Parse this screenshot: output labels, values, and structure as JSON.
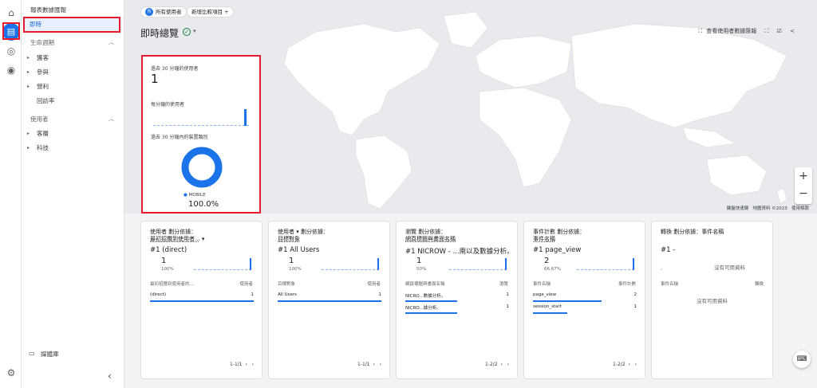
{
  "rail": {
    "icons": [
      "home-icon",
      "reports-icon",
      "explore-icon",
      "advertising-icon",
      "settings-icon"
    ]
  },
  "sidebar": {
    "header": "報表數據匯報",
    "selected": "即時",
    "lifecycle": {
      "label": "生命週期",
      "items": [
        "獲客",
        "參與",
        "營利",
        "回訪率"
      ]
    },
    "user": {
      "label": "使用者",
      "items": [
        "客層",
        "科技"
      ]
    },
    "library": "媒體庫",
    "collapse": "‹"
  },
  "header": {
    "audience_chip": "所有使用者",
    "audience_chip_initial": "所",
    "compare_chip": "新增比較項目",
    "compare_plus": "+",
    "title": "即時總覽",
    "tools": {
      "snapshot": "查看使用者數據匯報",
      "expand": "⛶",
      "edit": "☑",
      "share": "<"
    }
  },
  "map": {
    "zoom_in": "+",
    "zoom_out": "−",
    "attribution": [
      "鍵盤快速鍵",
      "地圖資料 ©2023",
      "使用條款"
    ]
  },
  "summary": {
    "users_label": "過去 30 分鐘的使用者",
    "users_value": "1",
    "per_minute_label": "每分鐘的使用者",
    "device_label": "過去 30 分鐘內的裝置類別",
    "donut_legend": "MOBILE",
    "donut_value": "100.0%"
  },
  "cards": [
    {
      "h1": "使用者 劃分依據：",
      "h2": "最初招攬到使用者...",
      "caret": "▾",
      "top": "#1 (direct)",
      "value": "1",
      "pct": "100%",
      "col1": "最初招攬到使用者的...",
      "col2": "使用者",
      "rows": [
        {
          "k": "(direct)",
          "v": "1"
        }
      ],
      "page": "1-1/1"
    },
    {
      "h1": "使用者 ▾ 劃分依據：",
      "h2": "目標對象",
      "top": "#1 All Users",
      "value": "1",
      "pct": "100%",
      "col1": "目標對象",
      "col2": "使用者",
      "rows": [
        {
          "k": "All Users",
          "v": "1"
        }
      ],
      "page": "1-1/1"
    },
    {
      "h1": "瀏覽 劃分依據：",
      "h2": "網頁標題與畫面名稱",
      "top": "#1 NICROW - ...南以及數據分析。",
      "value": "1",
      "pct": "50%",
      "col1": "網頁標題與畫面名稱",
      "col2": "瀏覽",
      "rows": [
        {
          "k": "NICRO...數據分析。",
          "v": "1"
        },
        {
          "k": "NICRO...據分析。",
          "v": "1"
        }
      ],
      "page": "1-2/2"
    },
    {
      "h1": "事件計數 劃分依據：",
      "h2": "事件名稱",
      "top": "#1 page_view",
      "value": "2",
      "pct": "66.67%",
      "col1": "事件名稱",
      "col2": "事件計數",
      "rows": [
        {
          "k": "page_view",
          "v": "2"
        },
        {
          "k": "session_start",
          "v": "1"
        }
      ],
      "page": "1-2/2"
    },
    {
      "h1": "轉換 劃分依據：事件名稱",
      "h2": "",
      "top": "#1 -",
      "col1": "事件名稱",
      "col2": "轉換",
      "none1": "沒有可用資料",
      "none2": "沒有可用資料",
      "dash": "-"
    }
  ],
  "nav": {
    "prev": "‹",
    "next": "›"
  },
  "feedback": "⌨",
  "colors": {
    "accent": "#1a73e8",
    "highlight": "#e8192c",
    "map_land": "#ffffff",
    "map_bg": "#e8eaed"
  }
}
